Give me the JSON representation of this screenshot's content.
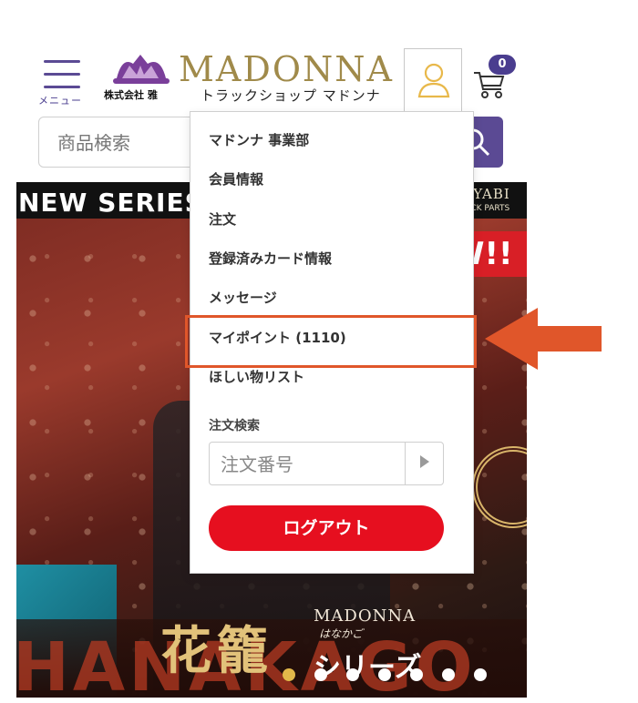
{
  "header": {
    "menu_label": "メニュー",
    "brand_name": "MADONNA",
    "company_name": "株式会社 雅",
    "subtitle": "トラックショップ マドンナ",
    "cart_count": "0"
  },
  "search": {
    "placeholder": "商品検索"
  },
  "dropdown": {
    "items": [
      "マドンナ 事業部",
      "会員情報",
      "注文",
      "登録済みカード情報",
      "メッセージ",
      "マイポイント (1110)",
      "ほしい物リスト"
    ],
    "order_search_label": "注文検索",
    "order_placeholder": "注文番号",
    "logout_label": "ログアウト"
  },
  "banner": {
    "series_text": "NEW SERIES",
    "miyabi": "MIYABI",
    "truck_parts": "TRUCK PARTS",
    "new_tag": "W!!",
    "big_word": "HANAKAGO",
    "madonna": "MADONNA",
    "kana": "はなかご",
    "title_jp": "花籠",
    "series_jp": "シリーズ",
    "slide_count": 7,
    "active_slide": 1
  },
  "colors": {
    "brand_purple": "#5b4a94",
    "brand_gold": "#a08a4a",
    "logout_red": "#e60f1f",
    "annotation_orange": "#e0562a"
  },
  "icons": {
    "menu": "hamburger-icon",
    "user": "user-icon",
    "cart": "cart-icon",
    "search": "search-icon",
    "submit": "play-triangle-icon",
    "annotation": "arrow-left-icon"
  }
}
